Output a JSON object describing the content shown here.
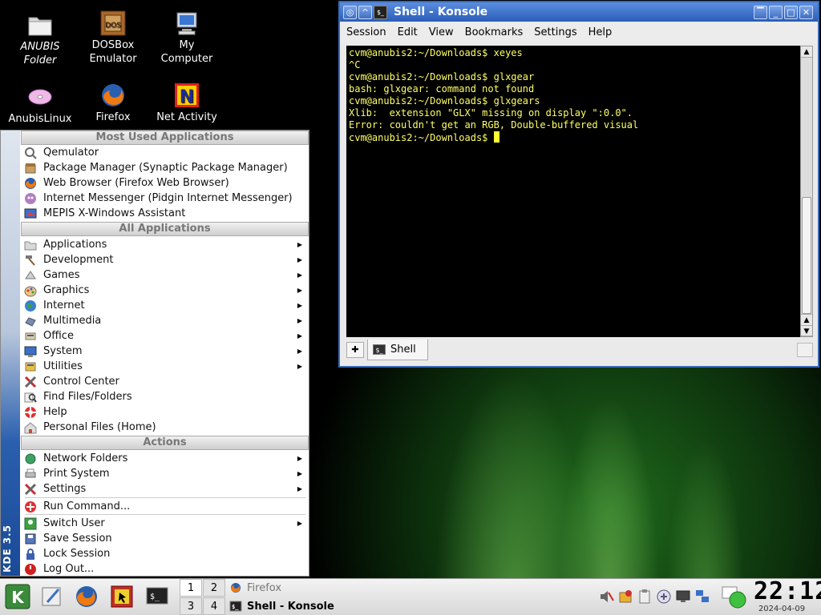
{
  "desktop": {
    "icons": [
      {
        "label": "ANUBIS Folder",
        "icon": "folder-icon"
      },
      {
        "label": "DOSBox Emulator",
        "icon": "dosbox-icon"
      },
      {
        "label": "My Computer",
        "icon": "computer-icon"
      },
      {
        "label": "AnubisLinux",
        "icon": "cd-icon"
      },
      {
        "label": "Firefox",
        "icon": "firefox-icon"
      },
      {
        "label": "Net Activity",
        "icon": "net-activity-icon"
      }
    ]
  },
  "konsole": {
    "title": "Shell - Konsole",
    "menu": [
      "Session",
      "Edit",
      "View",
      "Bookmarks",
      "Settings",
      "Help"
    ],
    "terminal_lines": [
      "cvm@anubis2:~/Downloads$ xeyes",
      "^C",
      "cvm@anubis2:~/Downloads$ glxgear",
      "bash: glxgear: command not found",
      "cvm@anubis2:~/Downloads$ glxgears",
      "Xlib:  extension \"GLX\" missing on display \":0.0\".",
      "Error: couldn't get an RGB, Double-buffered visual"
    ],
    "prompt": "cvm@anubis2:~/Downloads$ ",
    "tab_label": "Shell"
  },
  "kmenu": {
    "version": "KDE 3.5",
    "header_most_used": "Most Used Applications",
    "most_used": [
      "Qemulator",
      "Package Manager (Synaptic Package Manager)",
      "Web Browser (Firefox Web Browser)",
      "Internet Messenger (Pidgin Internet Messenger)",
      "MEPIS X-Windows Assistant"
    ],
    "header_all": "All Applications",
    "all_apps": [
      "Applications",
      "Development",
      "Games",
      "Graphics",
      "Internet",
      "Multimedia",
      "Office",
      "System",
      "Utilities",
      "Control Center",
      "Find Files/Folders",
      "Help",
      "Personal Files (Home)"
    ],
    "header_actions": "Actions",
    "actions": [
      "Network Folders",
      "Print System",
      "Settings",
      "Run Command...",
      "Switch User",
      "Save Session",
      "Lock Session",
      "Log Out..."
    ]
  },
  "taskbar": {
    "pager": [
      "1",
      "2",
      "3",
      "4"
    ],
    "tasks": [
      "Firefox",
      "Shell - Konsole"
    ],
    "clock_time": "22:12",
    "clock_date": "2024-04-09"
  },
  "colors": {
    "accent": "#2a5db8",
    "terminal_fg": "#ffff66",
    "terminal_bg": "#000000"
  }
}
